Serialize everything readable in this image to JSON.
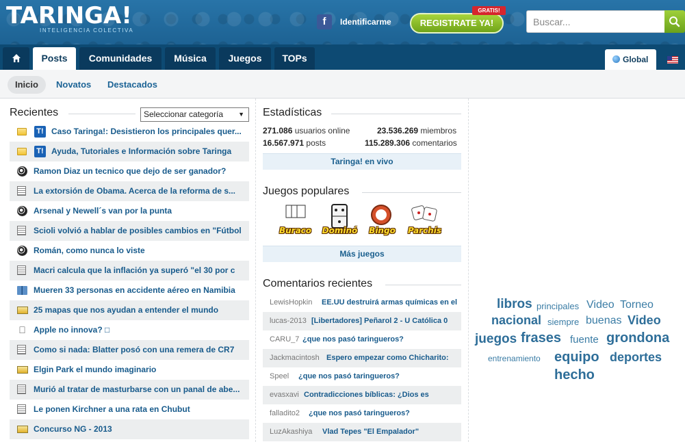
{
  "header": {
    "logo": "TARINGA!",
    "logo_sub": "INTELIGENCIA COLECTIVA",
    "facebook_icon": "f",
    "identify_label": "Identificarme",
    "register_label": "REGISTRATE YA!",
    "register_badge": "GRATIS!",
    "search_placeholder": "Buscar..."
  },
  "nav": {
    "tabs": [
      {
        "label": "Posts"
      },
      {
        "label": "Comunidades"
      },
      {
        "label": "Música"
      },
      {
        "label": "Juegos"
      },
      {
        "label": "TOPs"
      }
    ],
    "global_label": "Global"
  },
  "subnav": {
    "items": [
      {
        "label": "Inicio"
      },
      {
        "label": "Novatos"
      },
      {
        "label": "Destacados"
      }
    ]
  },
  "recientes": {
    "title": "Recientes",
    "category_select": "Seleccionar categoría",
    "posts": [
      {
        "icon": "folder-icon",
        "title": "Caso Taringa!: Desistieron los principales quer..."
      },
      {
        "icon": "folder-icon",
        "title": "Ayuda, Tutoriales e Información sobre Taringa"
      },
      {
        "icon": "soccer-ball-icon",
        "title": "Ramon Diaz un tecnico que dejo de ser ganador?"
      },
      {
        "icon": "newspaper-icon",
        "title": "La extorsión de Obama. Acerca de la reforma de s..."
      },
      {
        "icon": "soccer-ball-icon",
        "title": "Arsenal y Newell´s van por la punta"
      },
      {
        "icon": "newspaper-icon",
        "title": "Scioli volvió a hablar de posibles cambios en \"Fútbol"
      },
      {
        "icon": "soccer-ball-icon",
        "title": "Román, como nunca lo viste"
      },
      {
        "icon": "newspaper-icon",
        "title": "Macri calcula que la inflación ya superó \"el 30 por c"
      },
      {
        "icon": "book-icon",
        "title": "Mueren 33 personas en accidente aéreo en Namibia"
      },
      {
        "icon": "image-icon",
        "title": "25 mapas que nos ayudan a entender el mundo"
      },
      {
        "icon": "apple-icon",
        "title": "Apple no innova? □"
      },
      {
        "icon": "newspaper-icon",
        "title": "Como si nada: Blatter posó con una remera de CR7"
      },
      {
        "icon": "image-icon",
        "title": "Elgin Park el mundo imaginario"
      },
      {
        "icon": "newspaper-icon",
        "title": "Murió al tratar de masturbarse con un panal de abe..."
      },
      {
        "icon": "newspaper-icon",
        "title": "Le ponen Kirchner a una rata en Chubut"
      },
      {
        "icon": "image-icon",
        "title": "Concurso NG - 2013"
      }
    ]
  },
  "stats": {
    "title": "Estadísticas",
    "online_value": "271.086",
    "online_label": "usuarios online",
    "members_value": "23.536.269",
    "members_label": "miembros",
    "posts_value": "16.567.971",
    "posts_label": "posts",
    "comments_value": "115.289.306",
    "comments_label": "comentarios",
    "live_label": "Taringa! en vivo"
  },
  "games": {
    "title": "Juegos populares",
    "items": [
      {
        "label": "Buraco",
        "color": "#2f8c1c"
      },
      {
        "label": "Dominó",
        "color": "#2a2a2a"
      },
      {
        "label": "Bingo",
        "color": "#d5502a"
      },
      {
        "label": "Parchís",
        "color": "#c3332e"
      }
    ],
    "more_label": "Más juegos"
  },
  "comments": {
    "title": "Comentarios recientes",
    "items": [
      {
        "user": "LewisHopkin",
        "text": "EE.UU destruirá armas químicas en el"
      },
      {
        "user": "lucas-2013",
        "text": "[Libertadores] Peñarol 2 - U Católica 0"
      },
      {
        "user": "CARU_7",
        "text": "¿que nos pasó taringueros?"
      },
      {
        "user": "Jackmacintosh",
        "text": "Espero empezar como Chicharito:"
      },
      {
        "user": "Speel",
        "text": "¿que nos pasó taringueros?"
      },
      {
        "user": "evasxavi",
        "text": "Contradicciones bíblicas: ¿Dios es"
      },
      {
        "user": "falladito2",
        "text": "¿que nos pasó taringueros?"
      },
      {
        "user": "LuzAkashiya",
        "text": "Vlad Tepes \"El Empalador\""
      }
    ]
  },
  "tag_cloud": {
    "tags": [
      {
        "text": "libros"
      },
      {
        "text": "principales"
      },
      {
        "text": "Video"
      },
      {
        "text": "Torneo"
      },
      {
        "text": "nacional"
      },
      {
        "text": "siempre"
      },
      {
        "text": "buenas"
      },
      {
        "text": "Video"
      },
      {
        "text": "juegos"
      },
      {
        "text": "frases"
      },
      {
        "text": "fuente"
      },
      {
        "text": "grondona"
      },
      {
        "text": "entrenamiento"
      },
      {
        "text": "equipo"
      },
      {
        "text": "deportes"
      },
      {
        "text": "hecho"
      }
    ]
  }
}
